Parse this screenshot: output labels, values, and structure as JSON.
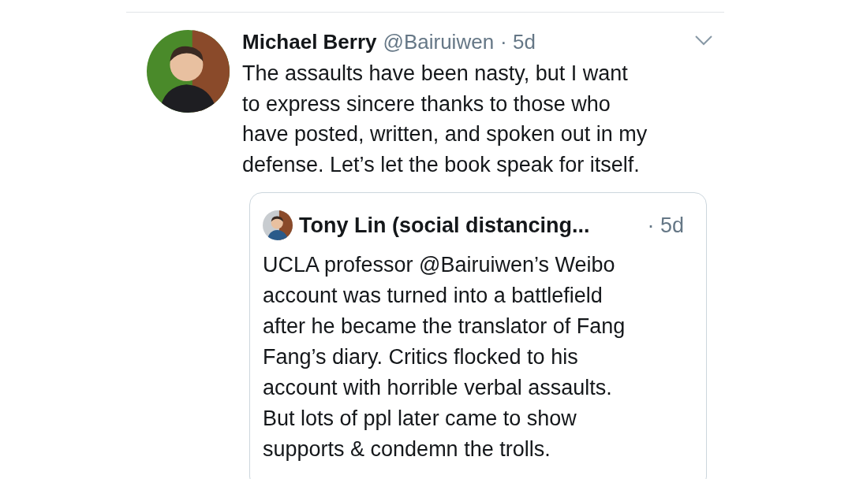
{
  "tweet": {
    "name": "Michael Berry",
    "handle": "@Bairuiwen",
    "time": "· 5d",
    "text": "The assaults have been nasty, but I want\nto express sincere thanks to those who\nhave posted, written, and spoken out in my\ndefense. Let’s let the book speak for itself.",
    "quoted": {
      "name": "Tony Lin (social distancing...",
      "time": "· 5d",
      "text": "UCLA professor @Bairuiwen’s Weibo\naccount was turned into a battlefield\nafter he became the translator of Fang\nFang’s diary. Critics flocked to his\naccount with horrible verbal assaults.\nBut lots of ppl later came to show\nsupports & condemn the trolls."
    }
  }
}
